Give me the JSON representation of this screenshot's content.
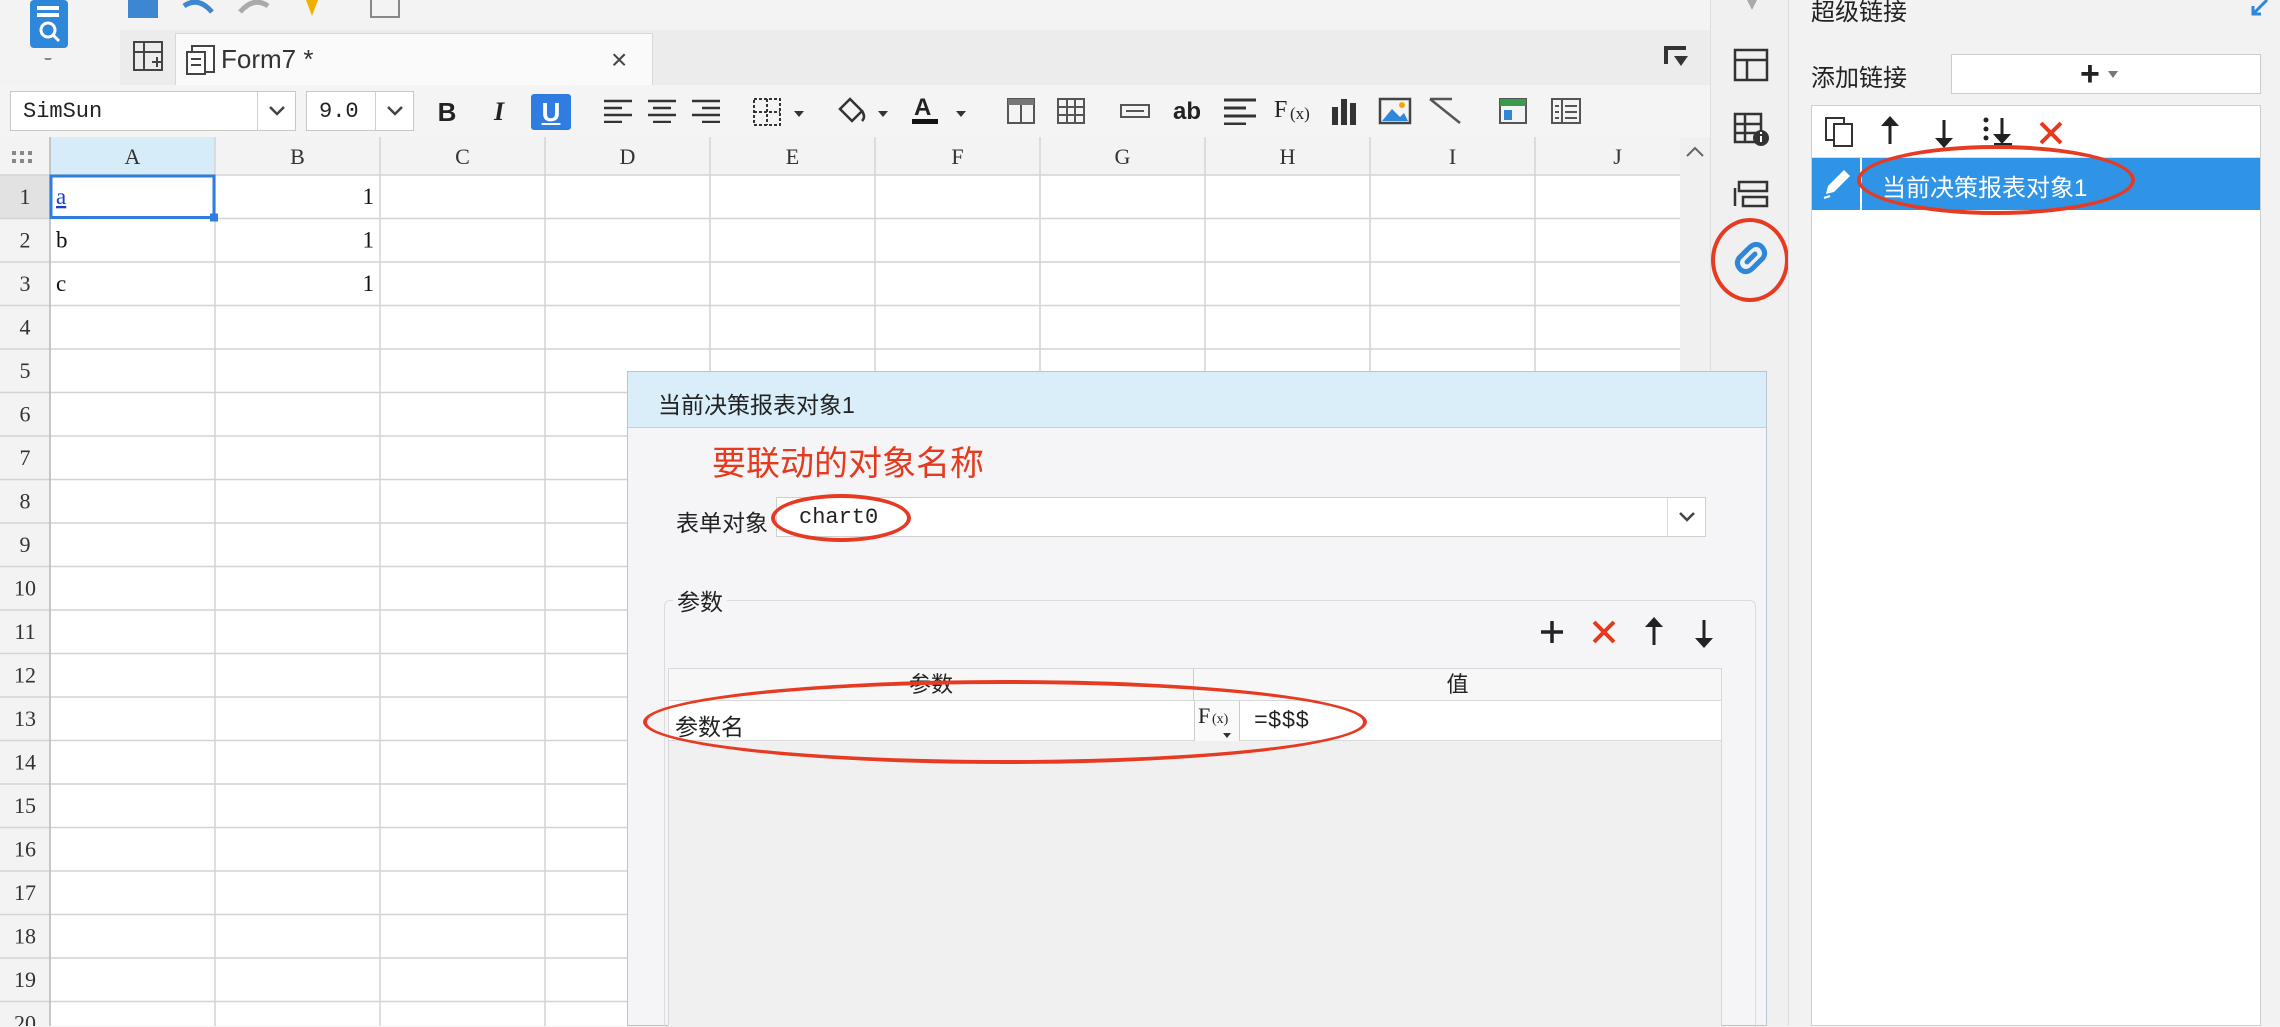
{
  "app": {
    "tab": {
      "title": "Form7 *",
      "close": "×"
    }
  },
  "format_toolbar": {
    "font_family": "SimSun",
    "font_size": "9.0",
    "bold": "B",
    "italic": "I",
    "underline": "U",
    "text_ab": "ab"
  },
  "spreadsheet": {
    "columns": [
      "A",
      "B",
      "C",
      "D",
      "E",
      "F",
      "G",
      "H",
      "I",
      "J"
    ],
    "rows": [
      "1",
      "2",
      "3",
      "4",
      "5",
      "6",
      "7",
      "8",
      "9",
      "10",
      "11",
      "12",
      "13",
      "14",
      "15",
      "16",
      "17",
      "18",
      "19",
      "20"
    ],
    "cells": [
      {
        "row": 1,
        "col": "A",
        "value": "a",
        "hyperlink": true
      },
      {
        "row": 1,
        "col": "B",
        "value": "1"
      },
      {
        "row": 2,
        "col": "A",
        "value": "b"
      },
      {
        "row": 2,
        "col": "B",
        "value": "1"
      },
      {
        "row": 3,
        "col": "A",
        "value": "c"
      },
      {
        "row": 3,
        "col": "B",
        "value": "1"
      }
    ],
    "selected_cell": "A1"
  },
  "right_panel": {
    "title": "超级链接",
    "add_label": "添加链接",
    "add_button": "+",
    "items": [
      {
        "label": "当前决策报表对象1",
        "selected": true
      }
    ]
  },
  "dialog": {
    "title": "当前决策报表对象1",
    "annotation": "要联动的对象名称",
    "form_object_label": "表单对象",
    "form_object_value": "chart0",
    "params_group": "参数",
    "table_headers": {
      "param": "参数",
      "value": "值"
    },
    "rows": [
      {
        "param": "参数名",
        "value": "=$$$"
      }
    ]
  },
  "colors": {
    "accent": "#2f94e6",
    "annotation": "#e53a1d",
    "dialog_header": "#d9eef9",
    "selection": "#2f7de1"
  }
}
